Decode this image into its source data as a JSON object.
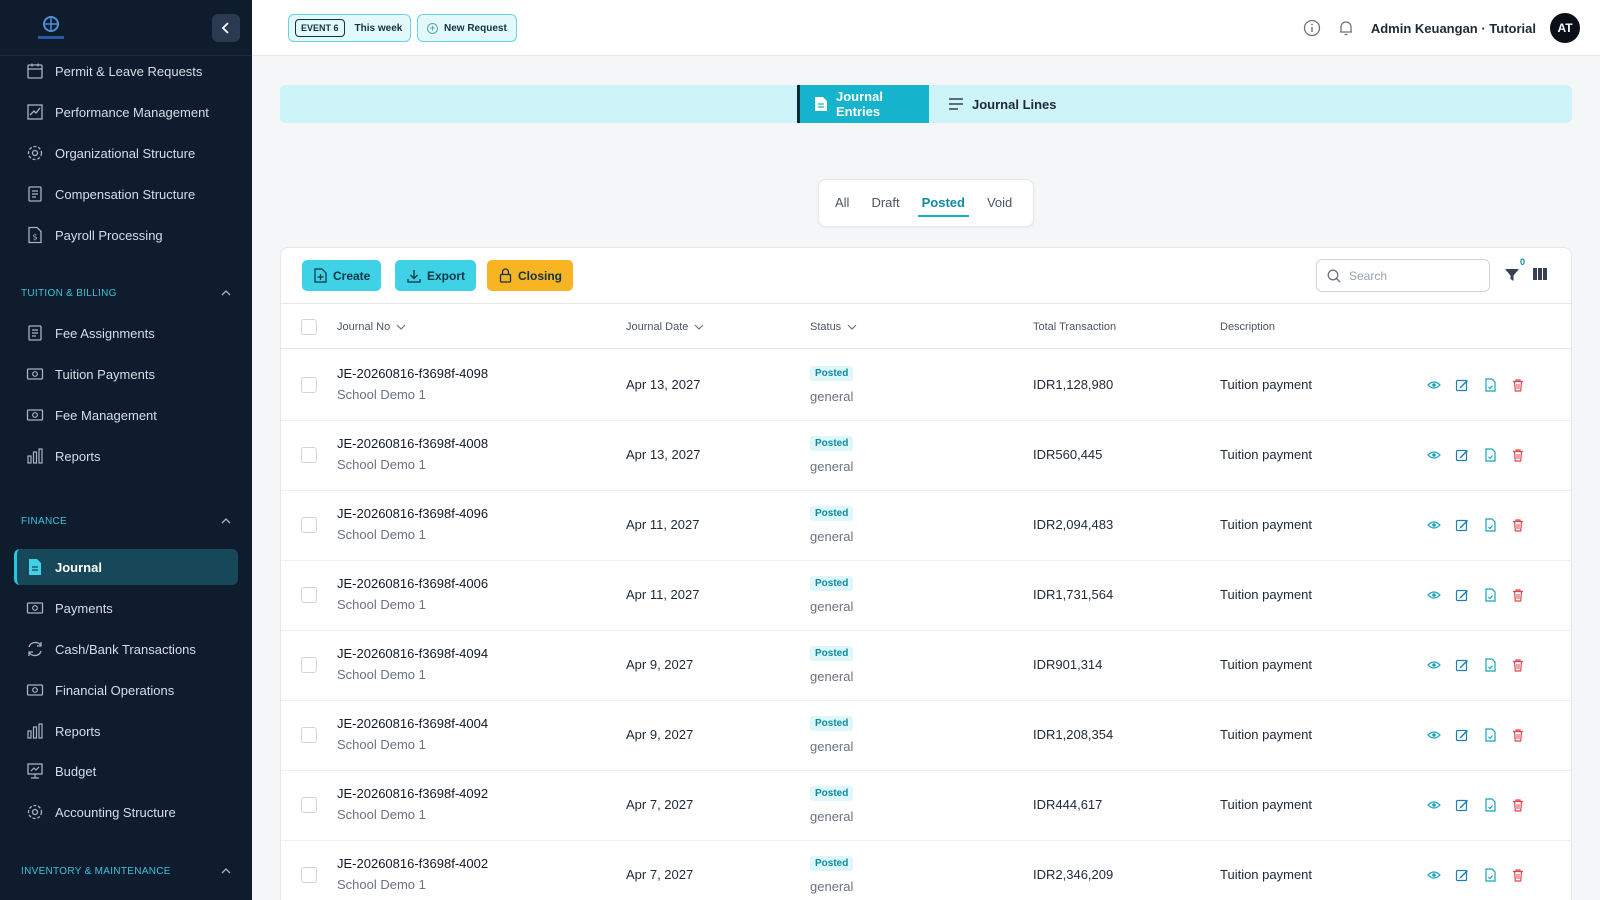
{
  "topbar": {
    "event_tag": "EVENT 6",
    "event_label": "This week",
    "new_request_label": "New Request",
    "user_label": "Admin Keuangan · Tutorial",
    "avatar_initials": "AT"
  },
  "sidebar": {
    "top_items": [
      {
        "label": "Permit & Leave Requests",
        "icon": "calendar-icon"
      },
      {
        "label": "Performance Management",
        "icon": "chart-line-icon"
      },
      {
        "label": "Organizational Structure",
        "icon": "gear-icon"
      },
      {
        "label": "Compensation Structure",
        "icon": "document-list-icon"
      },
      {
        "label": "Payroll Processing",
        "icon": "dollar-file-icon"
      }
    ],
    "sections": [
      {
        "title": "TUITION & BILLING",
        "items": [
          {
            "label": "Fee Assignments",
            "icon": "document-list-icon"
          },
          {
            "label": "Tuition Payments",
            "icon": "money-icon"
          },
          {
            "label": "Fee Management",
            "icon": "money-icon"
          },
          {
            "label": "Reports",
            "icon": "bar-chart-icon"
          }
        ]
      },
      {
        "title": "FINANCE",
        "items": [
          {
            "label": "Journal",
            "icon": "document-icon",
            "active": true
          },
          {
            "label": "Payments",
            "icon": "money-icon"
          },
          {
            "label": "Cash/Bank Transactions",
            "icon": "refresh-icon"
          },
          {
            "label": "Financial Operations",
            "icon": "money-icon"
          },
          {
            "label": "Reports",
            "icon": "bar-chart-icon"
          },
          {
            "label": "Budget",
            "icon": "presentation-icon"
          },
          {
            "label": "Accounting Structure",
            "icon": "gear-icon"
          }
        ]
      },
      {
        "title": "INVENTORY & MAINTENANCE",
        "items": []
      }
    ]
  },
  "tabs": {
    "journal_entries": "Journal Entries",
    "journal_lines": "Journal Lines"
  },
  "status_filter": {
    "options": [
      "All",
      "Draft",
      "Posted",
      "Void"
    ],
    "selected": "Posted"
  },
  "toolbar": {
    "create_label": "Create",
    "export_label": "Export",
    "closing_label": "Closing",
    "search_placeholder": "Search",
    "filter_count": "0"
  },
  "table": {
    "columns": {
      "journal_no": "Journal No",
      "journal_date": "Journal Date",
      "status": "Status",
      "total": "Total Transaction",
      "description": "Description"
    },
    "rows": [
      {
        "journal_no": "JE-20260816-f3698f-4098",
        "school": "School Demo 1",
        "date": "Apr 13, 2027",
        "status": "Posted",
        "type": "general",
        "total": "IDR1,128,980",
        "description": "Tuition payment"
      },
      {
        "journal_no": "JE-20260816-f3698f-4008",
        "school": "School Demo 1",
        "date": "Apr 13, 2027",
        "status": "Posted",
        "type": "general",
        "total": "IDR560,445",
        "description": "Tuition payment"
      },
      {
        "journal_no": "JE-20260816-f3698f-4096",
        "school": "School Demo 1",
        "date": "Apr 11, 2027",
        "status": "Posted",
        "type": "general",
        "total": "IDR2,094,483",
        "description": "Tuition payment"
      },
      {
        "journal_no": "JE-20260816-f3698f-4006",
        "school": "School Demo 1",
        "date": "Apr 11, 2027",
        "status": "Posted",
        "type": "general",
        "total": "IDR1,731,564",
        "description": "Tuition payment"
      },
      {
        "journal_no": "JE-20260816-f3698f-4094",
        "school": "School Demo 1",
        "date": "Apr 9, 2027",
        "status": "Posted",
        "type": "general",
        "total": "IDR901,314",
        "description": "Tuition payment"
      },
      {
        "journal_no": "JE-20260816-f3698f-4004",
        "school": "School Demo 1",
        "date": "Apr 9, 2027",
        "status": "Posted",
        "type": "general",
        "total": "IDR1,208,354",
        "description": "Tuition payment"
      },
      {
        "journal_no": "JE-20260816-f3698f-4092",
        "school": "School Demo 1",
        "date": "Apr 7, 2027",
        "status": "Posted",
        "type": "general",
        "total": "IDR444,617",
        "description": "Tuition payment"
      },
      {
        "journal_no": "JE-20260816-f3698f-4002",
        "school": "School Demo 1",
        "date": "Apr 7, 2027",
        "status": "Posted",
        "type": "general",
        "total": "IDR2,346,209",
        "description": "Tuition payment"
      }
    ]
  },
  "colors": {
    "sidebar_bg": "#0f1c2e",
    "accent_cyan": "#16b4cc",
    "button_cyan": "#3fd1e6",
    "button_orange": "#f8b422",
    "delete_red": "#e0454b"
  }
}
